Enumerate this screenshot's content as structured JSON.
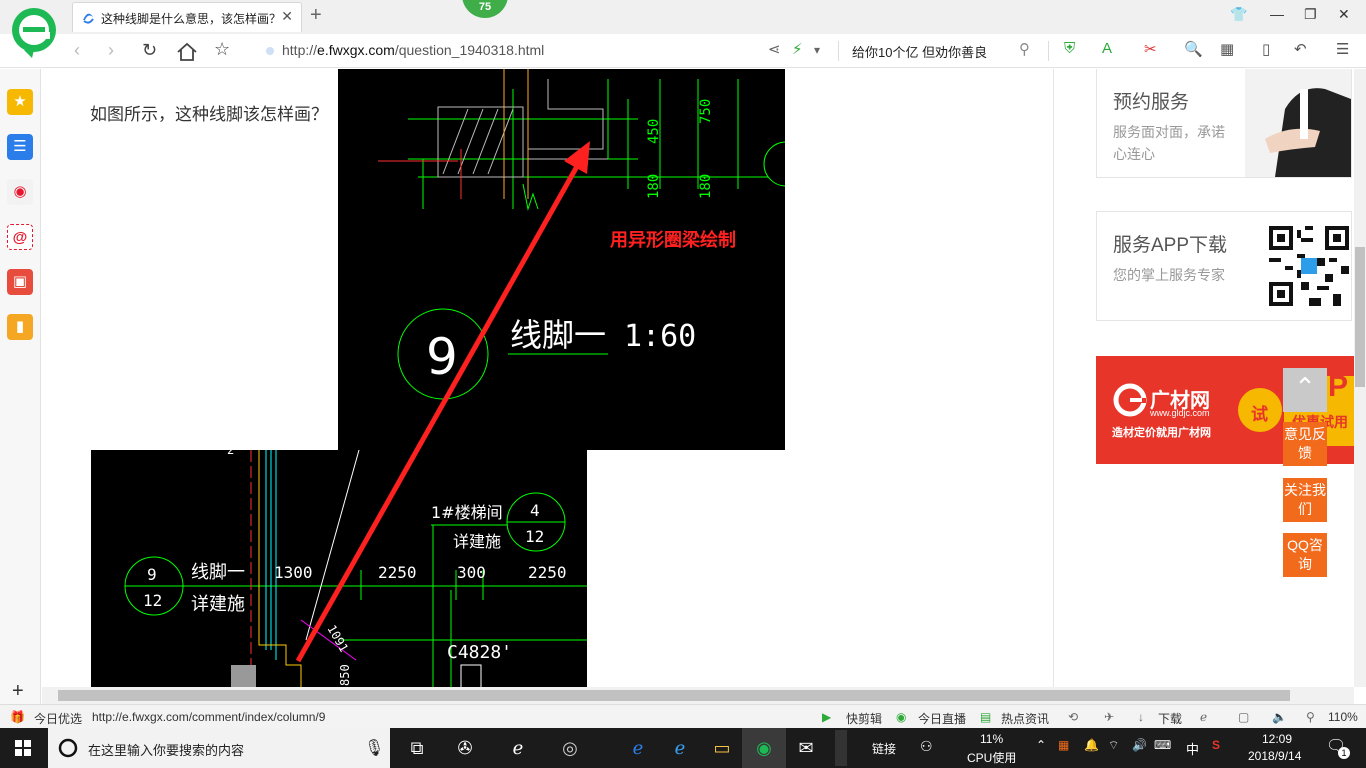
{
  "browser": {
    "tab_title": "这种线脚是什么意思，该怎样画？",
    "badge": "75",
    "url_domain": "e.fwxgx.com",
    "url_path": "/question_1940318.html",
    "url_scheme": "http://",
    "slogan": "给你10个亿 但劝你善良"
  },
  "page": {
    "question": "如图所示，这种线脚该怎样画？",
    "cad_top": {
      "dim_450": "450",
      "dim_750": "750",
      "dim_180a": "180",
      "dim_180b": "180",
      "annotation": "用异形圈梁绘制",
      "detail_number": "9",
      "detail_title": "线脚一",
      "detail_scale": "1:60"
    },
    "cad_bottom": {
      "ref_num": "9",
      "ref_sheet": "12",
      "ref_label_1": "线脚一",
      "ref_label_2": "详建施",
      "dim_1300": "1300",
      "dim_2250a": "2250",
      "dim_300": "300",
      "dim_2250b": "2250",
      "stair_label": "1#楼梯间",
      "stair_label_2": "详建施",
      "stair_num": "4",
      "stair_sheet": "12",
      "window_label": "C4828'",
      "diag_dim": "1091",
      "small_dim": "850",
      "edge_label": "2"
    },
    "sidebar_cards": [
      {
        "title": "预约服务",
        "sub": "服务面对面，承诺心连心"
      },
      {
        "title": "服务APP下载",
        "sub": "您的掌上服务专家"
      }
    ],
    "ad": {
      "brand": "广材网",
      "domain": "www.gldjc.com",
      "tagline": "造材定价就用广材网",
      "try": "试",
      "promo": "优惠试用",
      "p_letter": "P"
    },
    "float_buttons": [
      "意见反馈",
      "关注我们",
      "QQ咨询"
    ]
  },
  "statusbar": {
    "left_label": "今日优选",
    "link": "http://e.fwxgx.com/comment/index/column/9",
    "items": [
      "快剪辑",
      "今日直播",
      "热点资讯",
      "下载",
      "110%"
    ]
  },
  "taskbar": {
    "search_placeholder": "在这里输入你要搜索的内容",
    "link_label": "链接",
    "cpu_percent": "11%",
    "cpu_label": "CPU使用",
    "ime": "中",
    "time": "12:09",
    "date": "2018/9/14",
    "notif_count": "1"
  },
  "colors": {
    "accent_orange": "#f26a1b",
    "ad_red": "#e8352a",
    "cad_green": "#00ff00",
    "arrow_red": "#ff2020",
    "logo_green": "#1db954"
  }
}
